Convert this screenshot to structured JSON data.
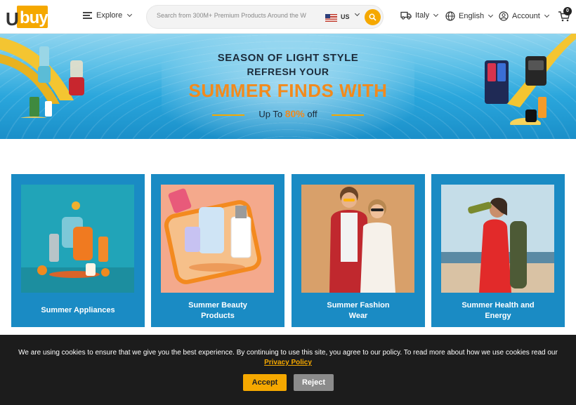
{
  "header": {
    "logo": {
      "u": "U",
      "buy": "buy"
    },
    "explore_label": "Explore",
    "search": {
      "placeholder": "Search from 300M+ Premium Products Around the W"
    },
    "country_code": "US",
    "ship_to": "Italy",
    "language": "English",
    "account": "Account",
    "cart_count": "0"
  },
  "banner": {
    "line1": "SEASON OF LIGHT STYLE",
    "line2": "REFRESH YOUR",
    "line3": "SUMMER FINDS WITH",
    "line4_prefix": "Up To",
    "line4_percent": "80%",
    "line4_suffix": "off"
  },
  "categories": [
    {
      "label_1": "Summer Appliances",
      "label_2": ""
    },
    {
      "label_1": "Summer Beauty",
      "label_2": "Products"
    },
    {
      "label_1": "Summer Fashion",
      "label_2": "Wear"
    },
    {
      "label_1": "Summer Health and",
      "label_2": "Energy"
    }
  ],
  "cookie": {
    "message": "We are using cookies to ensure that we give you the best experience. By continuing to use this site, you agree to our policy. To read more about how we use cookies read our",
    "policy_link": "Privacy Policy",
    "accept": "Accept",
    "reject": "Reject"
  },
  "colors": {
    "brand": "#f5a800",
    "card_bg": "#1a8bc4",
    "banner_accent": "#f28a1c",
    "cookie_bg": "#1c1c1c"
  }
}
